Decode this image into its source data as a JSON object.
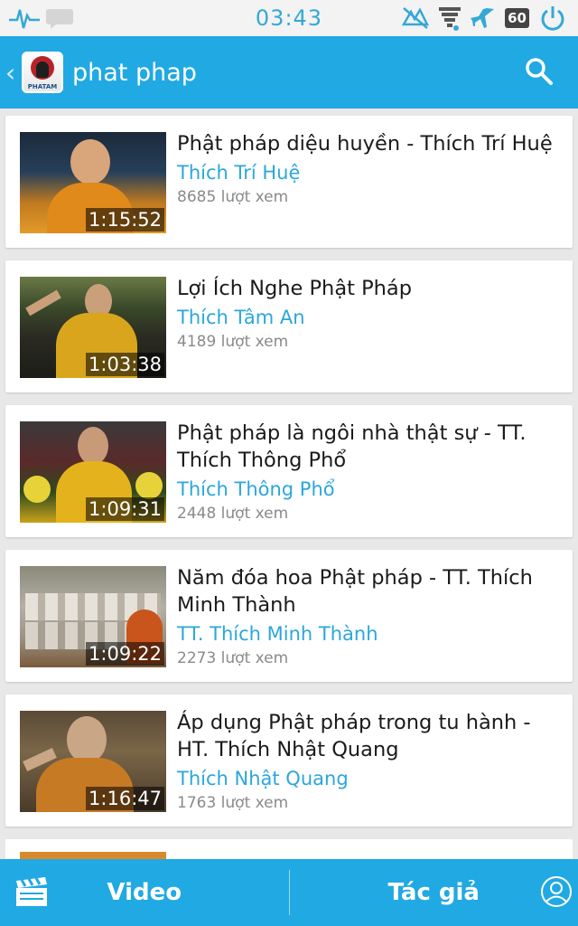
{
  "status_bar": {
    "time": "03:43",
    "battery_level": "60",
    "icons": [
      "pulse-icon",
      "chat-bubble-icon",
      "signal-blocked-icon",
      "data-funnel-icon",
      "airplane-icon",
      "battery-icon",
      "power-icon"
    ]
  },
  "action_bar": {
    "back_icon": "chevron-left-icon",
    "logo_text": "PHATAM",
    "title": "phat phap",
    "search_icon": "search-icon"
  },
  "videos": [
    {
      "title": "Phật pháp diệu huyền - Thích Trí Huệ",
      "author": "Thích Trí Huệ",
      "views": "8685 lượt xem",
      "duration": "1:15:52"
    },
    {
      "title": "Lợi Ích Nghe Phật Pháp",
      "author": "Thích Tâm An",
      "views": "4189 lượt xem",
      "duration": "1:03:38"
    },
    {
      "title": "Phật pháp là ngôi nhà thật sự - TT. Thích Thông Phổ",
      "author": "Thích Thông Phổ",
      "views": "2448 lượt xem",
      "duration": "1:09:31"
    },
    {
      "title": "Năm đóa hoa Phật pháp - TT. Thích Minh Thành",
      "author": "TT. Thích Minh Thành",
      "views": "2273 lượt xem",
      "duration": "1:09:22"
    },
    {
      "title": "Áp dụng Phật pháp trong tu hành - HT. Thích Nhật Quang",
      "author": "Thích Nhật Quang",
      "views": "1763 lượt xem",
      "duration": "1:16:47"
    }
  ],
  "bottom_nav": {
    "video_label": "Video",
    "author_label": "Tác giả",
    "left_icon": "clapperboard-icon",
    "right_icon": "user-profile-icon"
  },
  "colors": {
    "accent": "#21a9e3",
    "author_text": "#2ba7da",
    "views_text": "#8a8a8a",
    "status_time": "#35a8d6"
  }
}
